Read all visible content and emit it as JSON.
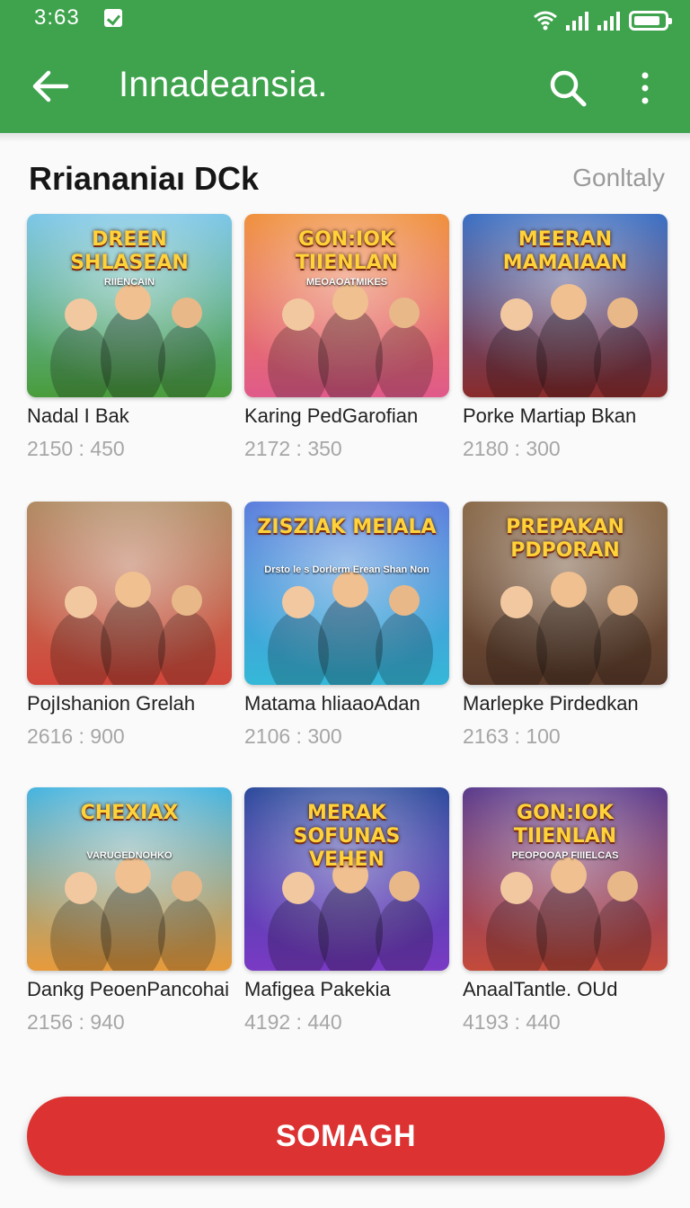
{
  "status_bar": {
    "time": "3:63"
  },
  "app_bar": {
    "title": "Innadeansia.",
    "back_icon": "arrow-left-icon",
    "search_icon": "search-icon",
    "more_icon": "more-vert-icon"
  },
  "section": {
    "title": "Rriananiaı DCk",
    "action": "Gonltaly"
  },
  "games": [
    {
      "name": "Nadal I Bak",
      "meta": "2150 : 450",
      "art_title": "DREEN SHLASEAN",
      "art_sub": "RIIENCAIN",
      "palette": [
        "#7bc6e8",
        "#4a9c3c"
      ]
    },
    {
      "name": "Karing PedGarofian",
      "meta": "2172 : 350",
      "art_title": "GON:IOK TIIENLAN",
      "art_sub": "MEOAOATMIKES",
      "palette": [
        "#f0903c",
        "#e05a8a"
      ]
    },
    {
      "name": "Porke Martiap Bkan",
      "meta": "2180 : 300",
      "art_title": "MEERAN MAMAIAAN",
      "art_sub": "",
      "palette": [
        "#3a6fc4",
        "#8a2b2b"
      ]
    },
    {
      "name": "PojIshanion Grelah",
      "meta": "2616 : 900",
      "art_title": "",
      "art_sub": "",
      "palette": [
        "#b08a62",
        "#d2463a"
      ]
    },
    {
      "name": "Matama hliaaoAdan",
      "meta": "2106 : 300",
      "art_title": "ZISZIAK MEIALA",
      "art_sub": "Drsto le s Dorlerm Erean Shan Non",
      "palette": [
        "#5a7ddc",
        "#35b8d8"
      ]
    },
    {
      "name": "Marlepke Pirdedkan",
      "meta": "2163 : 100",
      "art_title": "PREPAKAN PDPORAN",
      "art_sub": "",
      "palette": [
        "#8a6a4a",
        "#5a3a2a"
      ]
    },
    {
      "name": "Dankg PeoenPancohai",
      "meta": "2156 : 940",
      "art_title": "CHEXIAX",
      "art_sub": "VARUGEDNOHKO",
      "palette": [
        "#45b4e0",
        "#e89a3a"
      ]
    },
    {
      "name": "Mafigea Pakekia",
      "meta": "4192 : 440",
      "art_title": "MERAK SOFUNAS VEHEN",
      "art_sub": "",
      "palette": [
        "#2c4a9c",
        "#7a3ac4"
      ]
    },
    {
      "name": "AnaalTantle. OUd",
      "meta": "4193 : 440",
      "art_title": "GON:IOK TIIENLAN",
      "art_sub": "PEOPOOAP FIIIELCAS",
      "palette": [
        "#5a3a8c",
        "#c44a3a"
      ]
    }
  ],
  "button": {
    "label": "SOMAGH"
  }
}
